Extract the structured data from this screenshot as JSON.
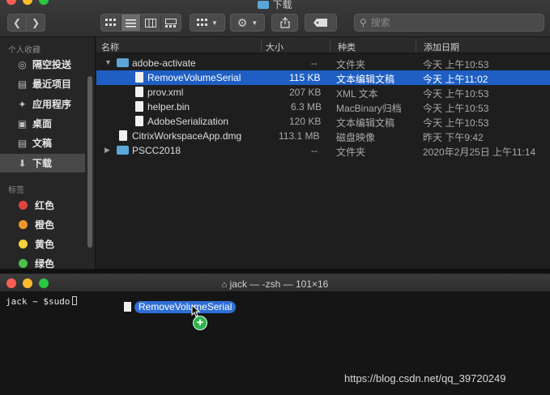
{
  "finder": {
    "title": "下载",
    "search": {
      "placeholder": "搜索"
    },
    "sidebar": {
      "favorites_header": "个人收藏",
      "favorites": [
        {
          "label": "隔空投送",
          "icon": "airdrop-icon"
        },
        {
          "label": "最近项目",
          "icon": "recents-icon"
        },
        {
          "label": "应用程序",
          "icon": "applications-icon"
        },
        {
          "label": "桌面",
          "icon": "desktop-icon"
        },
        {
          "label": "文稿",
          "icon": "documents-icon"
        },
        {
          "label": "下载",
          "icon": "downloads-icon",
          "selected": true
        }
      ],
      "tags_header": "标签",
      "tags": [
        {
          "label": "红色",
          "color": "#e0443c"
        },
        {
          "label": "橙色",
          "color": "#f0962e"
        },
        {
          "label": "黄色",
          "color": "#f4d33c"
        },
        {
          "label": "绿色",
          "color": "#4dc04a"
        }
      ]
    },
    "columns": {
      "name": "名称",
      "size": "大小",
      "kind": "种类",
      "date": "添加日期"
    },
    "rows": [
      {
        "name": "adobe-activate",
        "size": "--",
        "kind": "文件夹",
        "date": "今天 上午10:53",
        "type": "folder",
        "expanded": true
      },
      {
        "name": "RemoveVolumeSerial",
        "size": "115 KB",
        "kind": "文本编辑文稿",
        "date": "今天 上午11:02",
        "type": "file",
        "selected": true
      },
      {
        "name": "prov.xml",
        "size": "207 KB",
        "kind": "XML 文本",
        "date": "今天 上午10:53",
        "type": "file"
      },
      {
        "name": "helper.bin",
        "size": "6.3 MB",
        "kind": "MacBinary归档",
        "date": "今天 上午10:53",
        "type": "file"
      },
      {
        "name": "AdobeSerialization",
        "size": "120 KB",
        "kind": "文本编辑文稿",
        "date": "今天 上午10:53",
        "type": "file"
      },
      {
        "name": "CitrixWorkspaceApp.dmg",
        "size": "113.1 MB",
        "kind": "磁盘映像",
        "date": "昨天 下午9:42",
        "type": "file"
      },
      {
        "name": "PSCC2018",
        "size": "--",
        "kind": "文件夹",
        "date": "2020年2月25日 上午11:14",
        "type": "folder",
        "expanded": false
      }
    ]
  },
  "terminal": {
    "title": "jack — -zsh — 101×16",
    "prompt": "jack ~ $sudo",
    "drag_item": "RemoveVolumeSerial"
  },
  "watermark": "https://blog.csdn.net/qq_39720249",
  "colors": {
    "selection": "#1f5fc4",
    "folder": "#5aa6d9",
    "close": "#ff5f57",
    "minimize": "#febc2e",
    "zoom": "#28c840"
  }
}
